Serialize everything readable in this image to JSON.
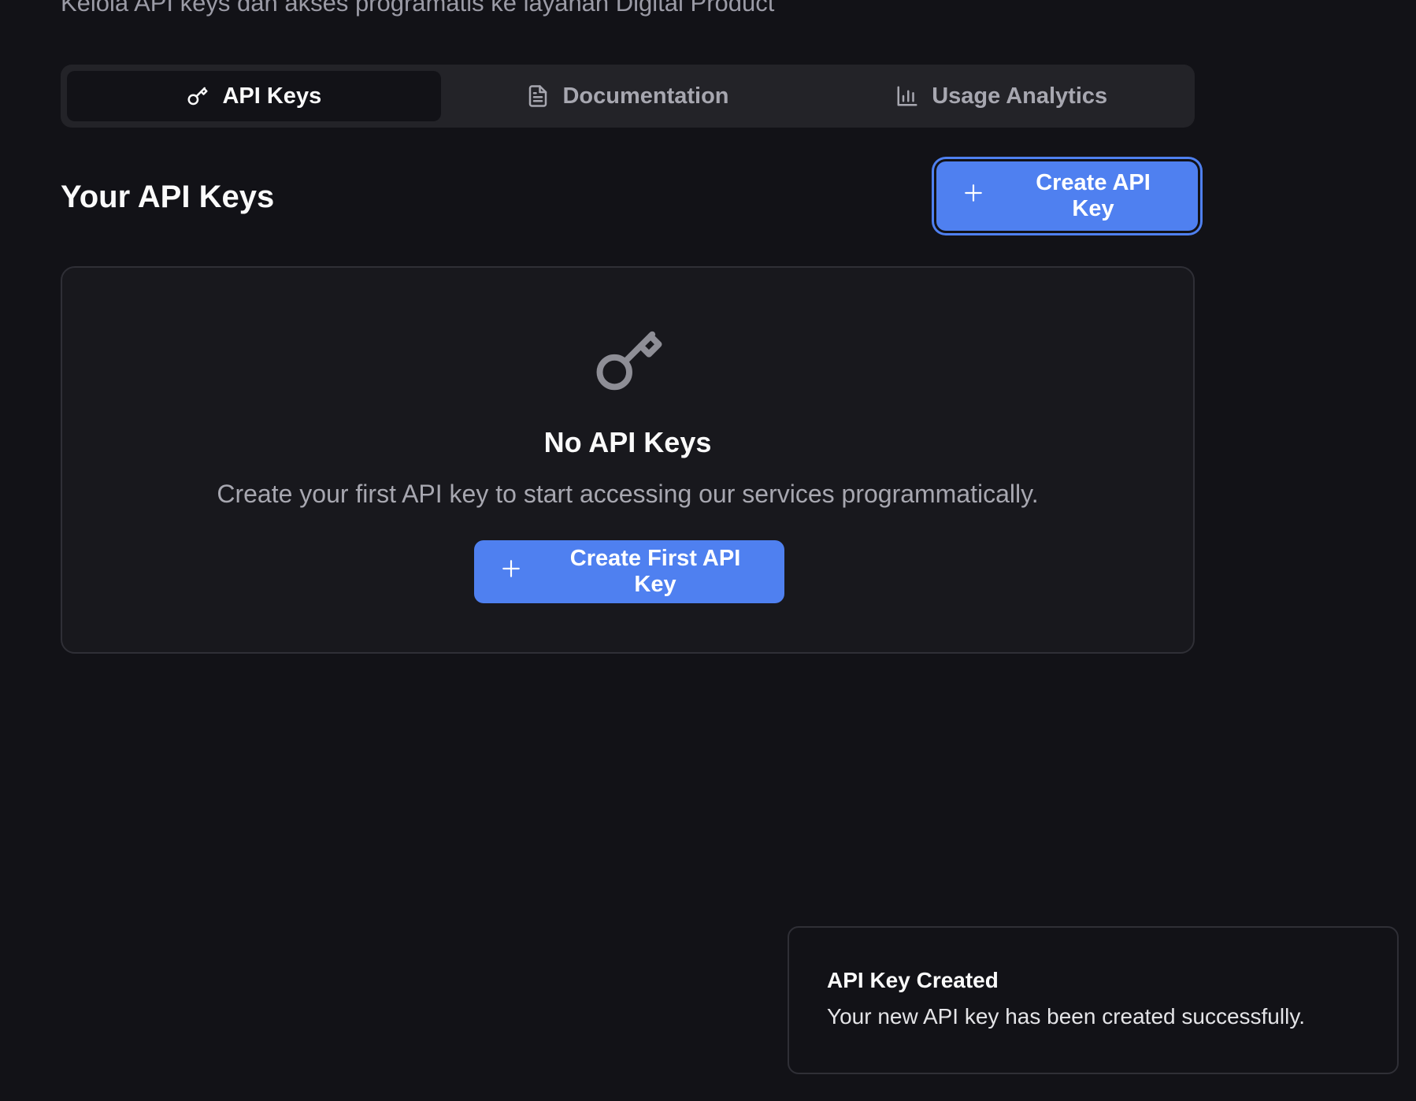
{
  "header": {
    "subtitle": "Kelola API keys dan akses programatis ke layanan Digital Product"
  },
  "tabs": [
    {
      "label": "API Keys",
      "icon": "key-icon",
      "active": true
    },
    {
      "label": "Documentation",
      "icon": "document-icon",
      "active": false
    },
    {
      "label": "Usage Analytics",
      "icon": "bar-chart-icon",
      "active": false
    }
  ],
  "section": {
    "title": "Your API Keys",
    "create_button_label": "Create API Key",
    "create_button_icon": "plus-icon"
  },
  "empty_state": {
    "icon": "key-icon",
    "title": "No API Keys",
    "description": "Create your first API key to start accessing our services programmatically.",
    "button_label": "Create First API Key",
    "button_icon": "plus-icon"
  },
  "toast": {
    "title": "API Key Created",
    "description": "Your new API key has been created successfully."
  },
  "colors": {
    "background": "#121217",
    "accent": "#4f80f0",
    "card": "#18181d",
    "muted_text": "#a7a7b0"
  }
}
